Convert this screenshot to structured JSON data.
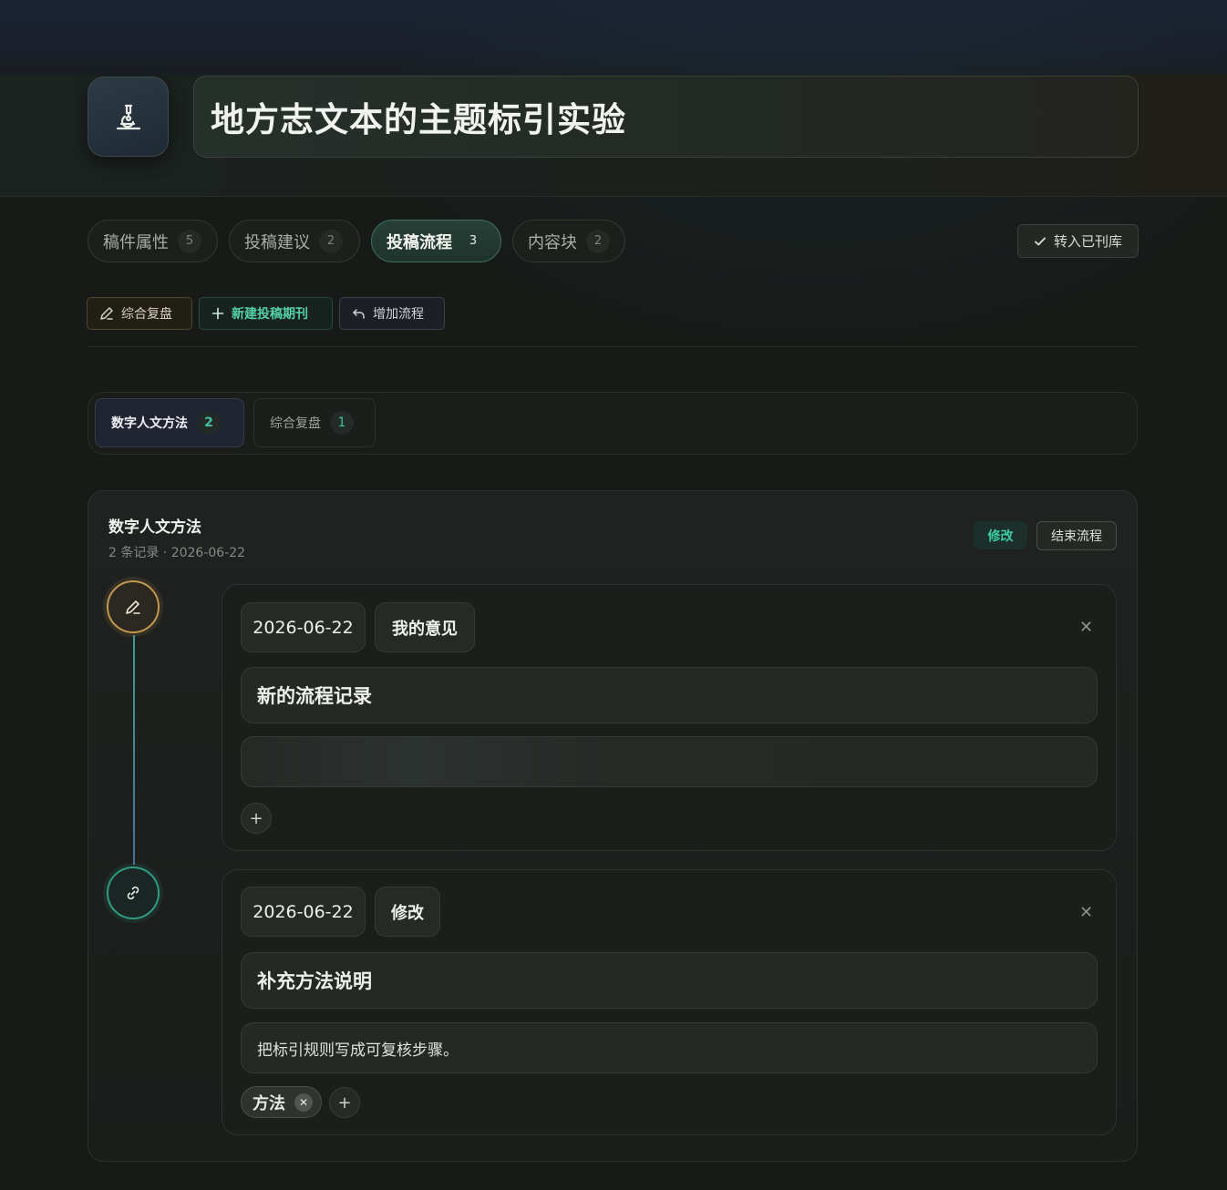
{
  "header": {
    "title": "地方志文本的主题标引实验",
    "icon": "microscope-icon"
  },
  "tabs": [
    {
      "label": "稿件属性",
      "count": "5"
    },
    {
      "label": "投稿建议",
      "count": "2"
    },
    {
      "label": "投稿流程",
      "count": "3",
      "active": true
    },
    {
      "label": "内容块",
      "count": "2"
    }
  ],
  "actions": {
    "archive_label": "转入已刊库"
  },
  "toolbar": {
    "review_label": "综合复盘",
    "new_journal_label": "新建投稿期刊",
    "add_flow_label": "增加流程"
  },
  "subtabs": [
    {
      "label": "数字人文方法",
      "count": "2",
      "active": true
    },
    {
      "label": "综合复盘",
      "count": "1"
    }
  ],
  "panel": {
    "title": "数字人文方法",
    "meta": "2 条记录 · 2026-06-22",
    "status_badge": "修改",
    "end_label": "结束流程"
  },
  "records": [
    {
      "date": "2026-06-22",
      "type": "我的意见",
      "title": "新的流程记录",
      "body": "",
      "node_icon": "pencil-icon",
      "tags": []
    },
    {
      "date": "2026-06-22",
      "type": "修改",
      "title": "补充方法说明",
      "body": "把标引规则写成可复核步骤。",
      "node_icon": "link-icon",
      "tags": [
        "方法"
      ]
    }
  ],
  "colors": {
    "accent_green": "#3ccda6",
    "accent_gold": "#c4974e",
    "background": "#181a18"
  }
}
